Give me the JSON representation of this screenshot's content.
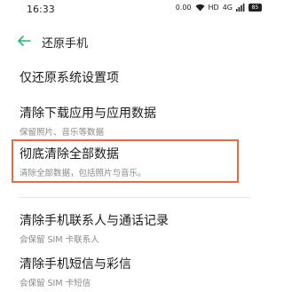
{
  "status_bar": {
    "time": "16:33",
    "net_speed": "0.00",
    "hd": "HD",
    "signal": "4G",
    "battery": "85"
  },
  "header": {
    "title": "还原手机"
  },
  "items": [
    {
      "title": "仅还原系统设置项",
      "subtitle": ""
    },
    {
      "title": "清除下载应用与应用数据",
      "subtitle": "保留照片、音乐等数据"
    },
    {
      "title": "彻底清除全部数据",
      "subtitle": "清除全部数据，包括照片与音乐。"
    },
    {
      "title": "清除手机联系人与通话记录",
      "subtitle": "会保留 SIM 卡联系人"
    },
    {
      "title": "清除手机短信与彩信",
      "subtitle": "会保留 SIM 卡短信"
    }
  ],
  "colors": {
    "accent": "#2bb673",
    "highlight_border": "#ef6a3a"
  }
}
